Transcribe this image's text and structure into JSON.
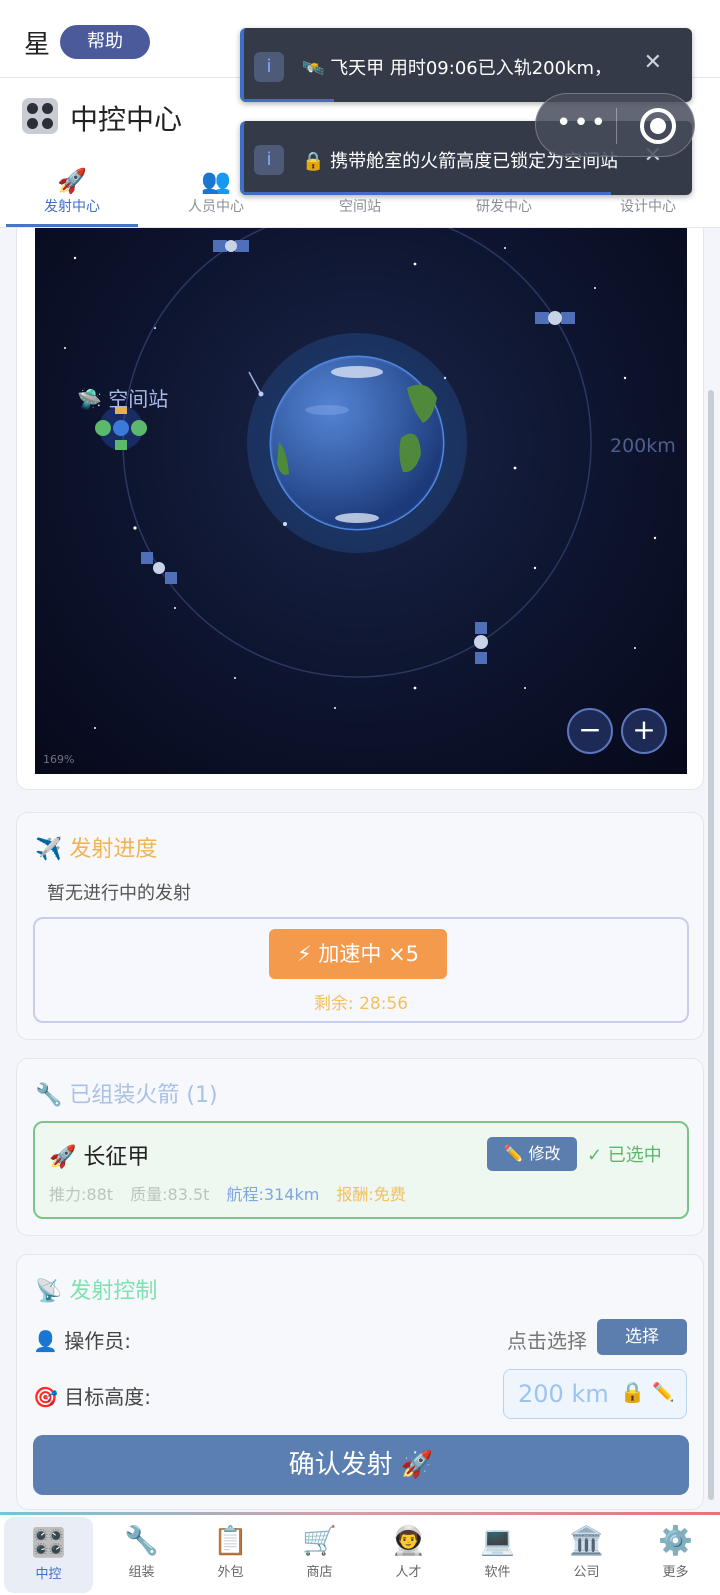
{
  "header": {
    "star_char": "星",
    "help_label": "帮助"
  },
  "app": {
    "title": "中控中心"
  },
  "tabs": [
    {
      "label": "发射中心",
      "icon": "rocket-icon",
      "glyph": "🚀",
      "active": true
    },
    {
      "label": "人员中心",
      "icon": "people-icon",
      "glyph": "👥",
      "active": false
    },
    {
      "label": "空间站",
      "icon": "station-icon",
      "glyph": "",
      "active": false
    },
    {
      "label": "研发中心",
      "icon": "research-icon",
      "glyph": "",
      "active": false
    },
    {
      "label": "设计中心",
      "icon": "design-icon",
      "glyph": "",
      "active": false
    }
  ],
  "notifications": [
    {
      "icon": "info-icon",
      "text": "🛰️ 飞天甲 用时09:06已入轨200km，",
      "progress": 0.2
    },
    {
      "icon": "info-icon",
      "text": "🔒 携带舱室的火箭高度已锁定为空间站",
      "progress": 0.82
    }
  ],
  "map": {
    "station_label": "空间站",
    "orbit_label": "200km",
    "zoom_level": "169%",
    "zoom_out": "−",
    "zoom_in": "+"
  },
  "launch_progress": {
    "title": "发射进度",
    "empty_text": "暂无进行中的发射",
    "speed_button": "⚡ 加速中 ×5",
    "remaining": "剩余: 28:56"
  },
  "rockets": {
    "title": "已组装火箭 (1)",
    "items": [
      {
        "name": "长征甲",
        "edit_label": "✏️ 修改",
        "selected_label": "✓ 已选中",
        "thrust": "推力:88t",
        "mass": "质量:83.5t",
        "range": "航程:314km",
        "reward": "报酬:免费"
      }
    ]
  },
  "launch_control": {
    "title": "发射控制",
    "operator_label": "操作员:",
    "operator_hint": "点击选择",
    "select_button": "选择",
    "target_label": "目标高度:",
    "target_value": "200 km",
    "confirm_button": "确认发射 🚀"
  },
  "bottom_nav": [
    {
      "label": "中控",
      "icon": "control-icon",
      "glyph": "🎛️",
      "active": true
    },
    {
      "label": "组装",
      "icon": "wrench-icon",
      "glyph": "🔧",
      "active": false
    },
    {
      "label": "外包",
      "icon": "clipboard-icon",
      "glyph": "📋",
      "active": false
    },
    {
      "label": "商店",
      "icon": "cart-icon",
      "glyph": "🛒",
      "active": false
    },
    {
      "label": "人才",
      "icon": "talent-icon",
      "glyph": "👨‍🚀",
      "active": false
    },
    {
      "label": "软件",
      "icon": "laptop-icon",
      "glyph": "💻",
      "active": false
    },
    {
      "label": "公司",
      "icon": "building-icon",
      "glyph": "🏛️",
      "active": false
    },
    {
      "label": "更多",
      "icon": "gear-icon",
      "glyph": "⚙️",
      "active": false
    }
  ],
  "colors": {
    "accent": "#3f6fc5",
    "button": "#5c7eae",
    "speed": "#f39a4c",
    "selected": "#5cb66c"
  }
}
